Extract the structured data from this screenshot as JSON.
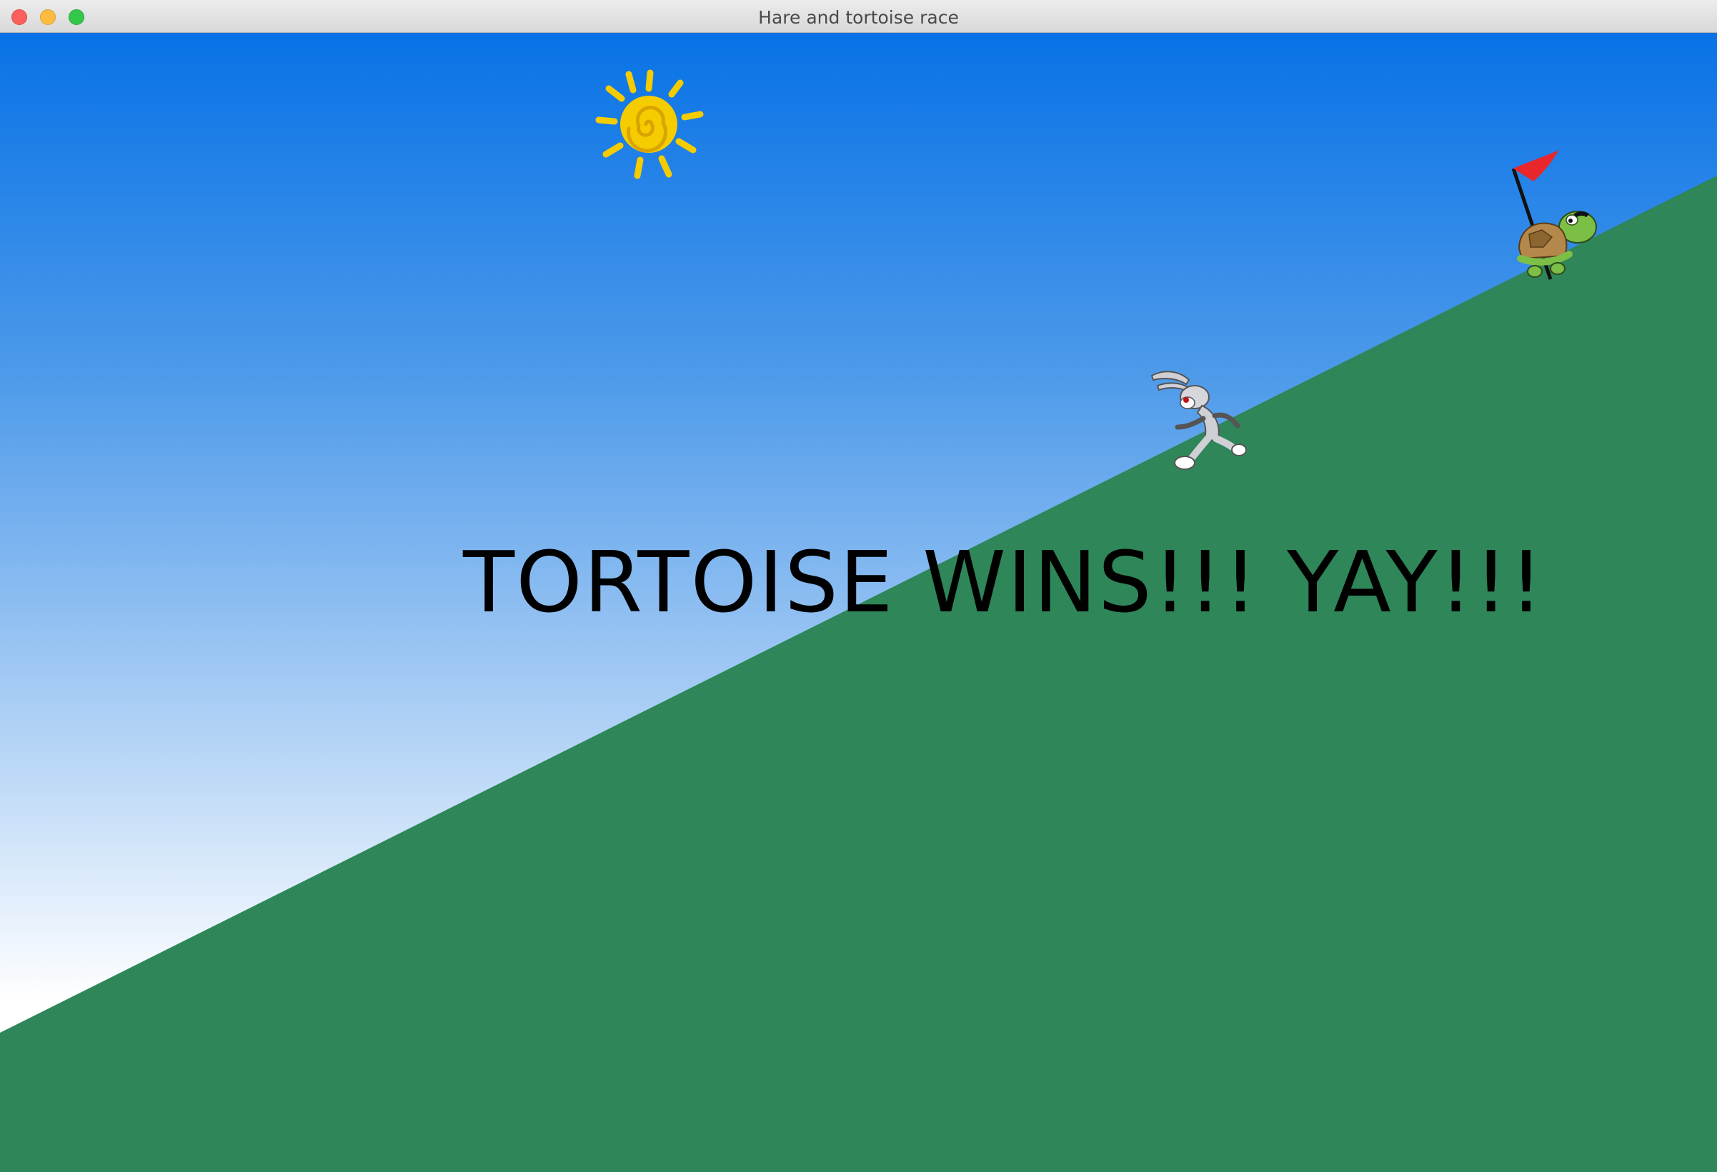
{
  "window": {
    "title": "Hare and tortoise race",
    "buttons": [
      "close",
      "minimize",
      "zoom"
    ]
  },
  "scene": {
    "sky_colors": [
      "#0872e6",
      "#ffffff"
    ],
    "hill_color": "#2e8659",
    "sun": {
      "icon": "sun-icon",
      "color": "#f5cc00"
    },
    "hare": {
      "icon": "hare-sprite"
    },
    "tortoise": {
      "icon": "tortoise-sprite",
      "flag_color": "#e8262b"
    },
    "message": "TORTOISE WINS!!! YAY!!!"
  }
}
